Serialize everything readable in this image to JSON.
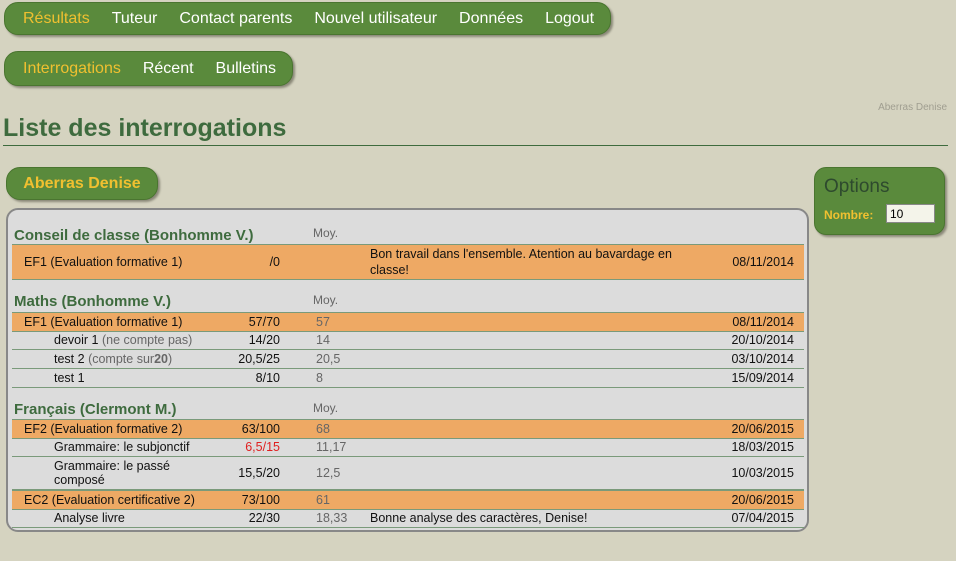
{
  "topnav": {
    "items": [
      "Résultats",
      "Tuteur",
      "Contact parents",
      "Nouvel utilisateur",
      "Données",
      "Logout"
    ],
    "active": "Résultats"
  },
  "subnav": {
    "items": [
      "Interrogations",
      "Récent",
      "Bulletins"
    ],
    "active": "Interrogations"
  },
  "user_name_small": "Aberras Denise",
  "page_title": "Liste des interrogations",
  "student_button": "Aberras Denise",
  "options": {
    "title": "Options",
    "nombre_label": "Nombre:",
    "nombre_value": "10"
  },
  "moy_label": "Moy.",
  "sections": [
    {
      "title": "Conseil de classe (Bonhomme V.)",
      "rows": [
        {
          "kind": "eval",
          "name": "EF1 (Evaluation formative 1)",
          "note": "/0",
          "avg": "",
          "comment": "Bon travail dans l'ensemble. Atention au bavardage en classe!",
          "date": "08/11/2014"
        }
      ]
    },
    {
      "title": "Maths (Bonhomme V.)",
      "rows": [
        {
          "kind": "eval",
          "name": "EF1 (Evaluation formative 1)",
          "note": "57/70",
          "avg": "57",
          "comment": "",
          "date": "08/11/2014"
        },
        {
          "kind": "sub",
          "name": "devoir 1",
          "note_extra": "(ne compte pas)",
          "note": "14/20",
          "avg": "14",
          "comment": "",
          "date": "20/10/2014"
        },
        {
          "kind": "sub",
          "name": "test 2",
          "note_extra_prefix": "(compte sur ",
          "note_extra_bold": "20",
          "note_extra_suffix": ")",
          "note": "20,5/25",
          "avg": "20,5",
          "comment": "",
          "date": "03/10/2014"
        },
        {
          "kind": "sub",
          "name": "test 1",
          "note": "8/10",
          "avg": "8",
          "comment": "",
          "date": "15/09/2014"
        }
      ]
    },
    {
      "title": "Français (Clermont M.)",
      "rows": [
        {
          "kind": "eval",
          "name": "EF2 (Evaluation formative 2)",
          "note": "63/100",
          "avg": "68",
          "comment": "",
          "date": "20/06/2015"
        },
        {
          "kind": "sub",
          "name": "Grammaire: le subjonctif",
          "note": "6,5/15",
          "note_color": "#e02020",
          "avg": "11,17",
          "comment": "",
          "date": "18/03/2015"
        },
        {
          "kind": "sub",
          "name": "Grammaire: le passé composé",
          "note": "15,5/20",
          "avg": "12,5",
          "comment": "",
          "date": "10/03/2015"
        },
        {
          "kind": "eval",
          "name": "EC2 (Evaluation certificative 2)",
          "note": "73/100",
          "avg": "61",
          "comment": "",
          "date": "20/06/2015"
        },
        {
          "kind": "sub",
          "name": "Analyse livre",
          "note": "22/30",
          "avg": "18,33",
          "comment": "Bonne analyse des caractères, Denise!",
          "date": "07/04/2015"
        }
      ]
    }
  ],
  "colors": {
    "background": "#d5d3c0",
    "nav_green": "#5a8a3c",
    "active_yellow": "#f0c030",
    "title_green": "#3e6b3e",
    "eval_row": "#eea964",
    "low_grade": "#e02020"
  }
}
